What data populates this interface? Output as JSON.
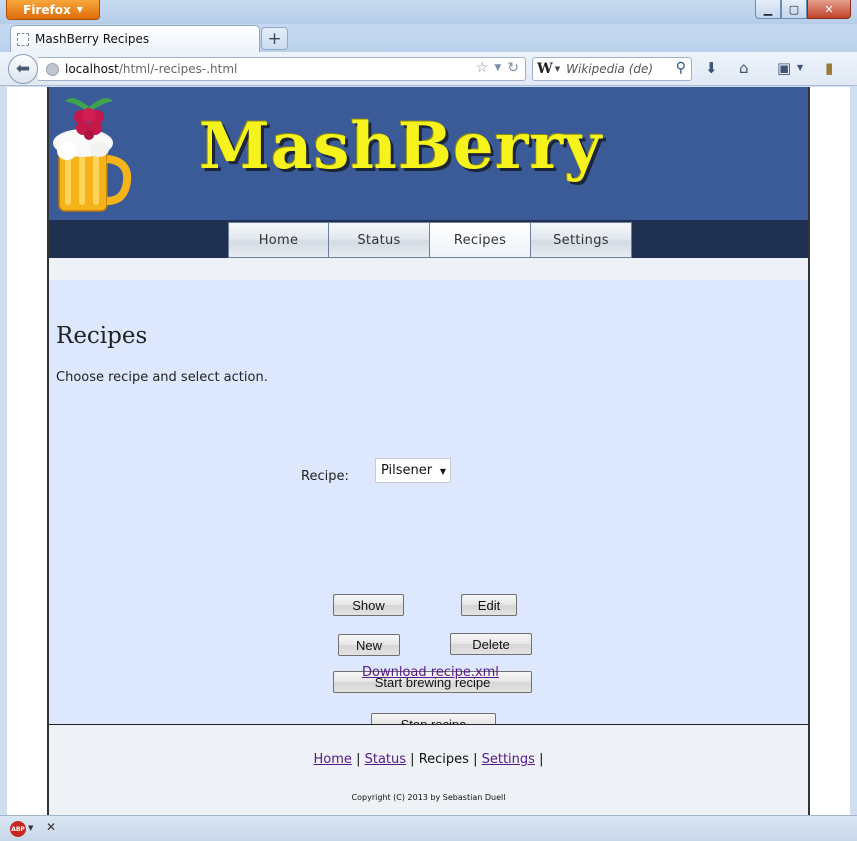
{
  "browser": {
    "app_button": "Firefox",
    "tab_title": "MashBerry Recipes",
    "new_tab_symbol": "+",
    "url_host": "localhost",
    "url_path": "/html/-recipes-.html",
    "search_engine_glyph": "W",
    "search_placeholder": "Wikipedia (de)",
    "abp_label": "ABP"
  },
  "site": {
    "title": "MashBerry",
    "menu": [
      {
        "label": "Home"
      },
      {
        "label": "Status"
      },
      {
        "label": "Recipes",
        "active": true
      },
      {
        "label": "Settings"
      }
    ]
  },
  "content": {
    "heading": "Recipes",
    "intro": "Choose recipe and select action.",
    "recipe_label": "Recipe:",
    "recipe_selected": "Pilsener",
    "buttons": {
      "show": "Show",
      "edit": "Edit",
      "new": "New",
      "delete": "Delete",
      "start": "Start brewing recipe",
      "stop": "Stop recipe"
    },
    "download_link": "Download recipe.xml"
  },
  "footer": {
    "links": [
      "Home",
      "Status",
      "Recipes",
      "Settings"
    ],
    "separator": "|",
    "copyright": "Copyright (C) 2013 by  Sebastian Duell"
  },
  "colors": {
    "header_bg": "#3a5b98",
    "menu_bg": "#1f3050",
    "title_yellow": "#f6f21c",
    "content_bg": "#dde8ff",
    "visited_link": "#551a8b"
  }
}
